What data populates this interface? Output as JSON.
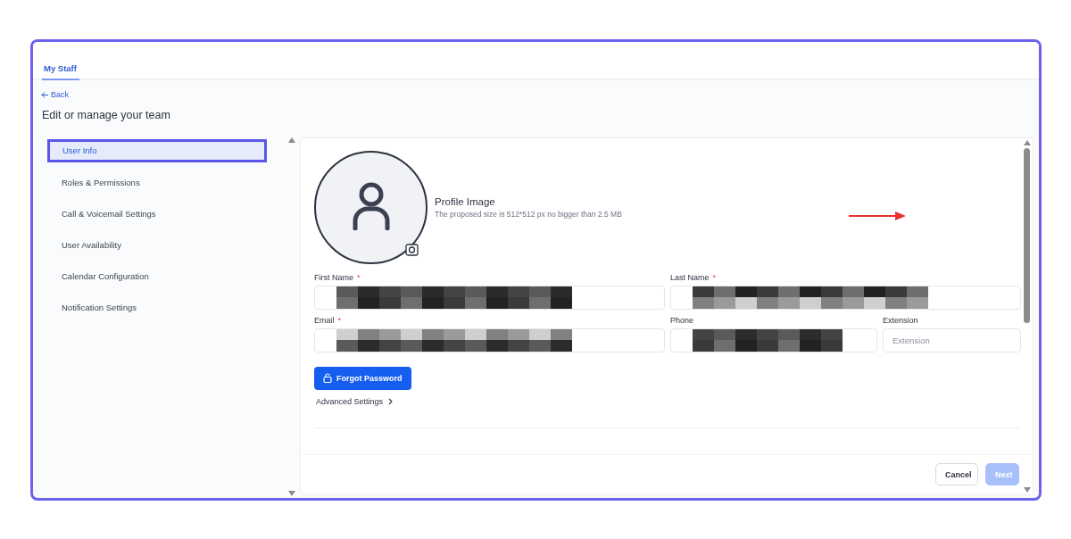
{
  "tabs": [
    {
      "label": "My Staff",
      "selected": true
    }
  ],
  "back_link": "Back",
  "heading": "Edit or manage your team",
  "sidebar": {
    "items": [
      {
        "label": "User Info",
        "selected": true
      },
      {
        "label": "Roles & Permissions",
        "selected": false
      },
      {
        "label": "Call & Voicemail Settings",
        "selected": false
      },
      {
        "label": "User Availability",
        "selected": false
      },
      {
        "label": "Calendar Configuration",
        "selected": false
      },
      {
        "label": "Notification Settings",
        "selected": false
      }
    ]
  },
  "profile_image": {
    "title": "Profile Image",
    "hint": "The proposed size is 512*512 px no bigger than 2.5 MB"
  },
  "fields": [
    {
      "label": "First Name",
      "required_mark": "*",
      "redacted": true
    },
    {
      "label": "Last Name",
      "required_mark": "*",
      "redacted": true
    },
    {
      "label": "Email",
      "required_mark": "*",
      "redacted": true
    },
    {
      "label": "Phone",
      "redacted": true
    },
    {
      "label": "Extension",
      "placeholder": "Extension",
      "redacted": false
    }
  ],
  "forgot_password_button": "Forgot Password",
  "advanced_settings": "Advanced Settings",
  "buttons": [
    {
      "label": "Cancel",
      "kind": "secondary",
      "disabled": false
    },
    {
      "label": "Next",
      "kind": "primary",
      "disabled": true
    }
  ]
}
